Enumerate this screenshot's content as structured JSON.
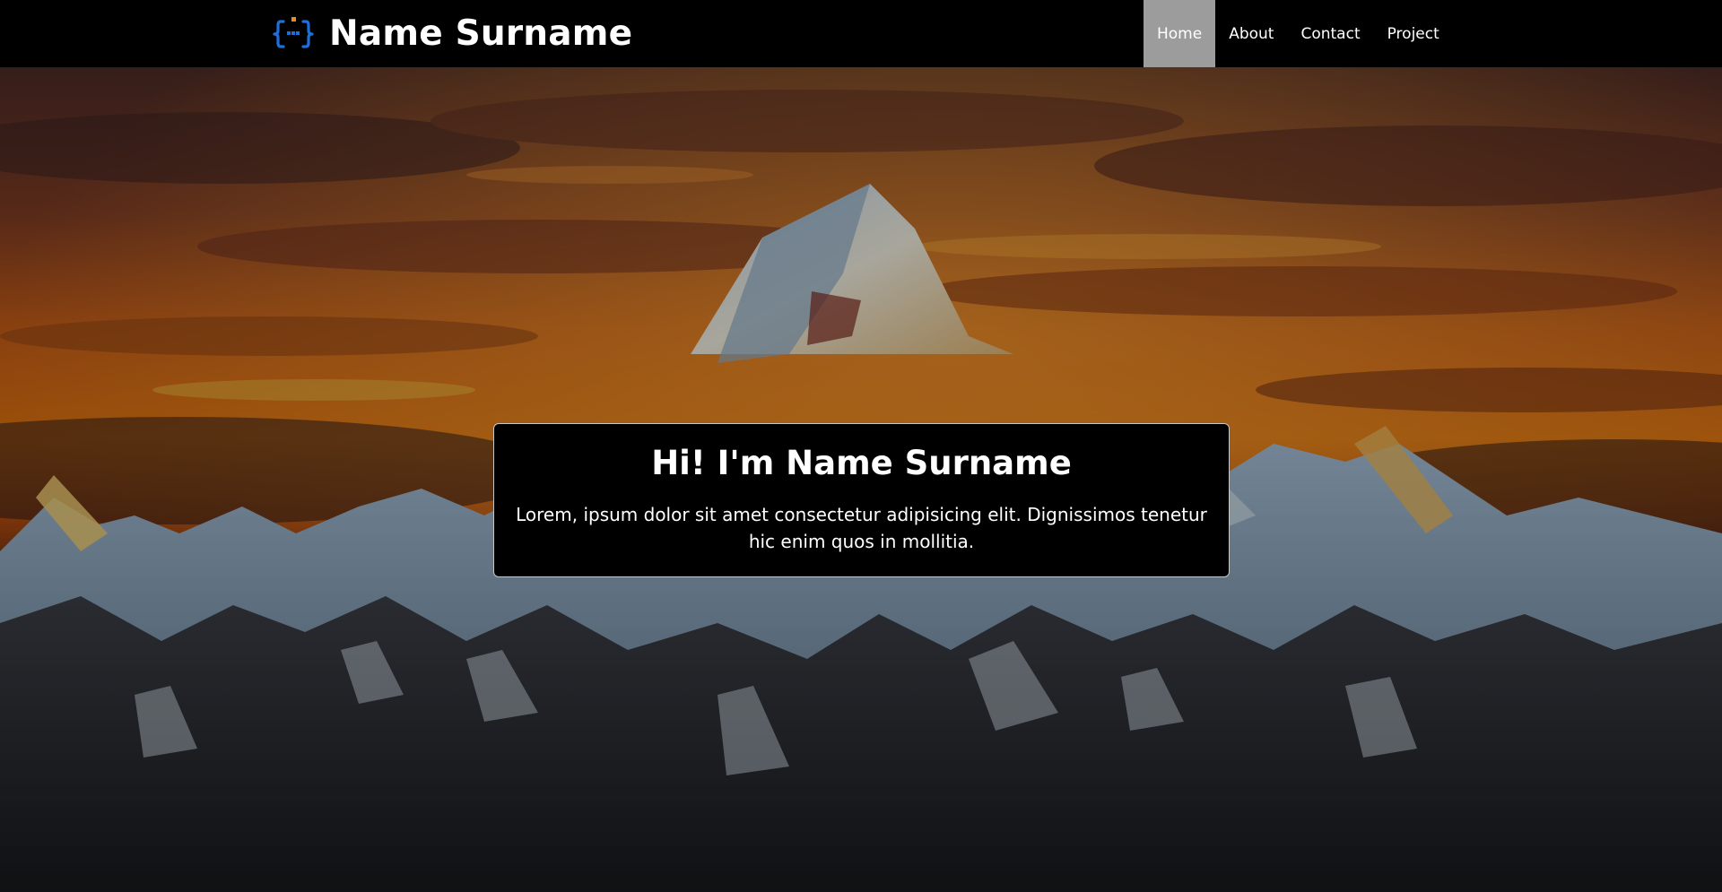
{
  "brand": {
    "icon": "code-braces-icon",
    "name": "Name Surname"
  },
  "nav": {
    "items": [
      {
        "label": "Home",
        "active": true
      },
      {
        "label": "About",
        "active": false
      },
      {
        "label": "Contact",
        "active": false
      },
      {
        "label": "Project",
        "active": false
      }
    ]
  },
  "hero": {
    "background": "mountain-sunset-image",
    "title": "Hi! I'm Name Surname",
    "text": "Lorem, ipsum dolor sit amet consectetur adipisicing elit. Dignissimos tenetur hic enim quos in mollitia."
  },
  "colors": {
    "navbar_bg": "#000000",
    "active_nav_bg": "#9c9c9c",
    "logo_blue": "#1e6fd9",
    "logo_orange": "#f08a1c",
    "card_bg": "#000000",
    "text": "#ffffff"
  }
}
